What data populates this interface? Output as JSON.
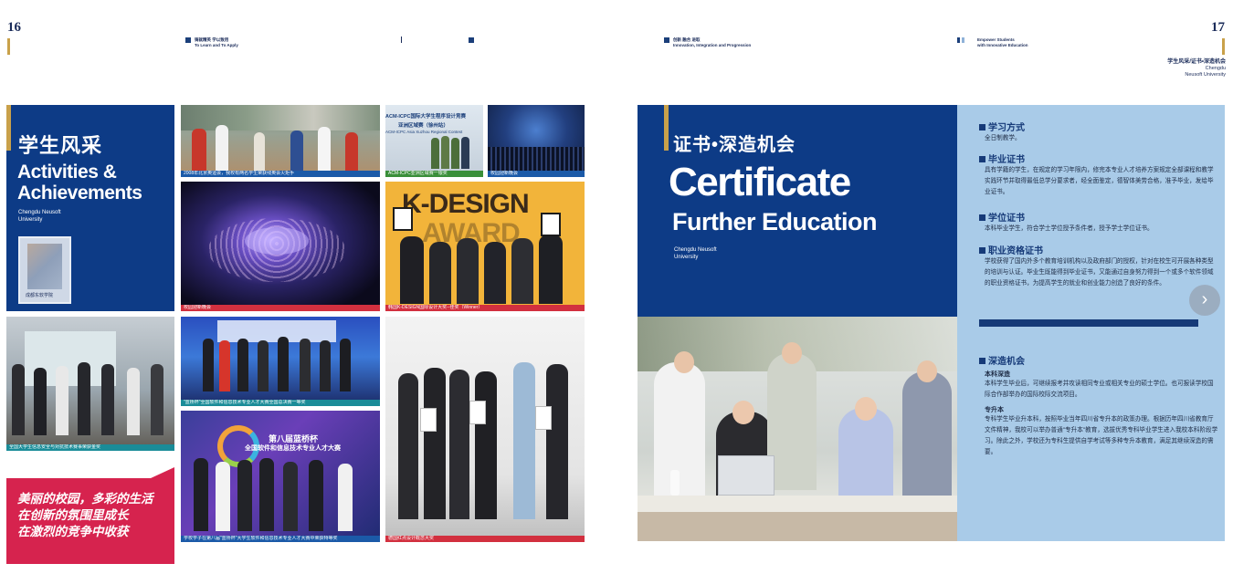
{
  "left_page": {
    "page_number": "16",
    "header_left": [
      "铸就精英 学以致用",
      "To Learn and To Apply"
    ],
    "panel": {
      "title_cn": "学生风采",
      "title_en_1": "Activities &",
      "title_en_2": "Achievements",
      "school_1": "Chengdu  Neusoft",
      "school_2": "University",
      "badge_text": "成都东软学院"
    },
    "photos": [
      {
        "caption": "2008年北京奥运会，我校有两名学生荣获残奥会火炬手"
      },
      {
        "caption": "ACM-ICPC亚洲区域赛一银奖",
        "sign_1": "ACM-ICPC国际大学生程序设计竞赛",
        "sign_2": "亚洲区域赛（徐州站）",
        "sign_3": "ACM-ICPC Asia Xuzhou Regional Contest"
      },
      {
        "caption": "校园迎新晚会"
      },
      {
        "caption": "校园迎新晚会"
      },
      {
        "caption": "韩国K-DESIGN国际设计大奖--佳奖（Winner）",
        "sign_1": "K-DESIGN",
        "sign_2": "AWARD"
      },
      {
        "caption": "全国大学生信息安全与对抗技术赛事荣获金奖"
      },
      {
        "caption": "\"蓝桥杯\"全国软件和信息技术专业人才大赛全国总决赛一等奖"
      },
      {
        "caption": "学校学子在第八届\"蓝桥杯\"大学生软件和信息技术专业人才大赛中荣获特等奖",
        "sign_1": "第八届蓝桥杯",
        "sign_2": "全国软件和信息技术专业人才大赛"
      },
      {
        "caption": "德国红点设计概念大奖"
      }
    ],
    "banner": [
      "美丽的校园，多彩的生活",
      "在创新的氛围里成长",
      "在激烈的竞争中收获"
    ]
  },
  "right_page": {
    "page_number": "17",
    "header_middle": [
      "创新 融合 进取",
      "Innovation, Integration and Progression"
    ],
    "header_right": [
      "Empower Students",
      "with Innovative Education"
    ],
    "top_label": "学生风采/证书•深造机会",
    "top_label_sub_1": "Chengdu",
    "top_label_sub_2": "Neusoft University",
    "panel": {
      "title_cn": "证书•深造机会",
      "title_en_1": "Certificate",
      "title_en_2": "Further Education",
      "school_1": "Chengdu  Neusoft",
      "school_2": "University"
    },
    "sections": [
      {
        "heading": "学习方式",
        "body": "全日制教学。"
      },
      {
        "heading": "毕业证书",
        "body": "具有学籍的学生，在规定的学习年限内，修完本专业人才培养方案规定全部课程和教学实践环节并取得最低总学分要求者，经全面鉴定，德智体美劳合格，准予毕业，发给毕业证书。"
      },
      {
        "heading": "学位证书",
        "body": "本科毕业学生，符合学士学位授予条件者，授予学士学位证书。"
      },
      {
        "heading": "职业资格证书",
        "body": "学校获得了国内外多个教育培训机构以及政府部门的授权，针对在校生可开展各种类型的培训与认证。毕业生既能得到毕业证书，又能通过自身努力得到一个或多个软件领域的职业资格证书，为提高学生的就业和创业能力创造了良好的条件。"
      }
    ],
    "further": {
      "heading": "深造机会",
      "sub1": "本科深造",
      "sub1_body": "本科学生毕业后，可继续报考并攻读相同专业或相关专业的硕士学位。也可报读学校国际合作部举办的国际校际交流项目。",
      "sub2": "专升本",
      "sub2_body": "专科学生毕业升本科，按照毕业当年四川省专升本的政策办理。根据历年四川省教育厅文件精神，我校可以举办普通\"专升本\"教育，选拔优秀专科毕业学生进入我校本科阶段学习。除此之外，学校还为专科生提供自学考试等多种专升本教育，满足其继续深造的需要。"
    },
    "nav_glyph": "›"
  },
  "colors": {
    "navy": "#0d3b86",
    "light_blue": "#a9cbe8",
    "red": "#d6234e",
    "gold": "#c9a14a"
  }
}
